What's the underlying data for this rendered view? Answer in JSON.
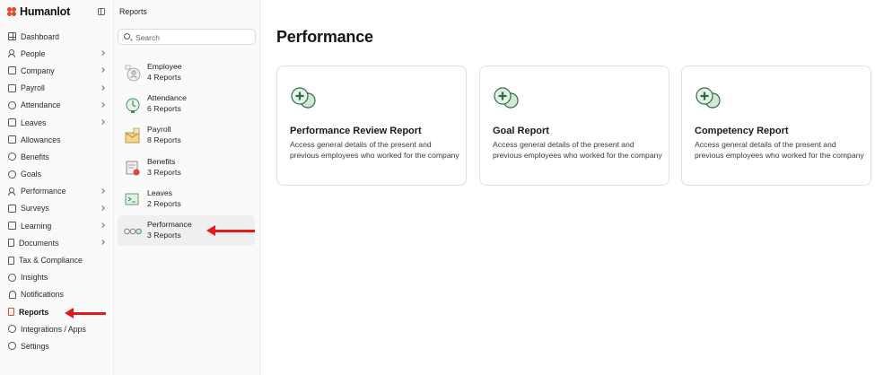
{
  "app": {
    "name": "Humanlot"
  },
  "sidebar": {
    "items": [
      {
        "label": "Dashboard",
        "icon": "dashboard-icon",
        "chevron": false
      },
      {
        "label": "People",
        "icon": "people-icon",
        "chevron": true
      },
      {
        "label": "Company",
        "icon": "company-icon",
        "chevron": true
      },
      {
        "label": "Payroll",
        "icon": "payroll-icon",
        "chevron": true
      },
      {
        "label": "Attendance",
        "icon": "attendance-icon",
        "chevron": true
      },
      {
        "label": "Leaves",
        "icon": "leaves-icon",
        "chevron": true
      },
      {
        "label": "Allowances",
        "icon": "allowances-icon",
        "chevron": false
      },
      {
        "label": "Benefits",
        "icon": "benefits-icon",
        "chevron": false
      },
      {
        "label": "Goals",
        "icon": "goals-icon",
        "chevron": false
      },
      {
        "label": "Performance",
        "icon": "performance-icon",
        "chevron": true
      },
      {
        "label": "Surveys",
        "icon": "surveys-icon",
        "chevron": true
      },
      {
        "label": "Learning",
        "icon": "learning-icon",
        "chevron": true
      },
      {
        "label": "Documents",
        "icon": "documents-icon",
        "chevron": true
      },
      {
        "label": "Tax & Compliance",
        "icon": "tax-icon",
        "chevron": false
      },
      {
        "label": "Insights",
        "icon": "insights-icon",
        "chevron": false
      },
      {
        "label": "Notifications",
        "icon": "bell-icon",
        "chevron": false
      },
      {
        "label": "Reports",
        "icon": "reports-icon",
        "chevron": false,
        "active": true
      },
      {
        "label": "Integrations / Apps",
        "icon": "integrations-icon",
        "chevron": false
      },
      {
        "label": "Settings",
        "icon": "gear-icon",
        "chevron": false
      }
    ]
  },
  "reports_panel": {
    "title": "Reports",
    "search": {
      "placeholder": "Search",
      "value": ""
    },
    "categories": [
      {
        "name": "Employee",
        "count": "4 Reports"
      },
      {
        "name": "Attendance",
        "count": "6 Reports"
      },
      {
        "name": "Payroll",
        "count": "8 Reports"
      },
      {
        "name": "Benefits",
        "count": "3 Reports"
      },
      {
        "name": "Leaves",
        "count": "2 Reports"
      },
      {
        "name": "Performance",
        "count": "3 Reports",
        "active": true
      }
    ]
  },
  "main": {
    "title": "Performance",
    "cards": [
      {
        "title": "Performance Review Report",
        "description": "Access general details of the present and previous employees who worked for the company"
      },
      {
        "title": "Goal Report",
        "description": "Access general details of the present and previous employees who worked for the company"
      },
      {
        "title": "Competency Report",
        "description": "Access general details of the present and previous employees who worked for the company"
      }
    ]
  },
  "colors": {
    "brand": "#e8492c",
    "annotation_arrow": "#e11b1b",
    "card_icon": "#3a9a5c"
  }
}
